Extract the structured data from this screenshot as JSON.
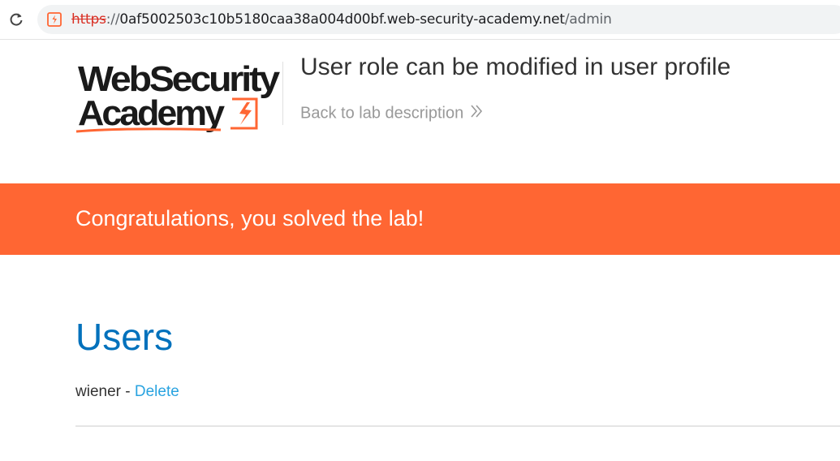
{
  "browser": {
    "url_scheme": "https",
    "url_scheme_sep": "://",
    "url_host": "0af5002503c10b5180caa38a004d00bf.web-security-academy.net",
    "url_path": "/admin",
    "reload_icon": "reload-icon",
    "site_icon": "not-secure-site-icon"
  },
  "header": {
    "logo_line1": "WebSecurity",
    "logo_line2": "Academy",
    "lab_title": "User role can be modified in user profile",
    "back_link": "Back to lab description",
    "back_icon": "double-chevron-right-icon"
  },
  "banner": {
    "text": "Congratulations, you solved the lab!",
    "color": "#ff6633"
  },
  "main": {
    "heading": "Users",
    "users": [
      {
        "name": "wiener",
        "separator": " - ",
        "action": "Delete"
      }
    ]
  },
  "colors": {
    "accent": "#ff6633",
    "heading": "#0071bc",
    "link": "#29a3e0"
  }
}
